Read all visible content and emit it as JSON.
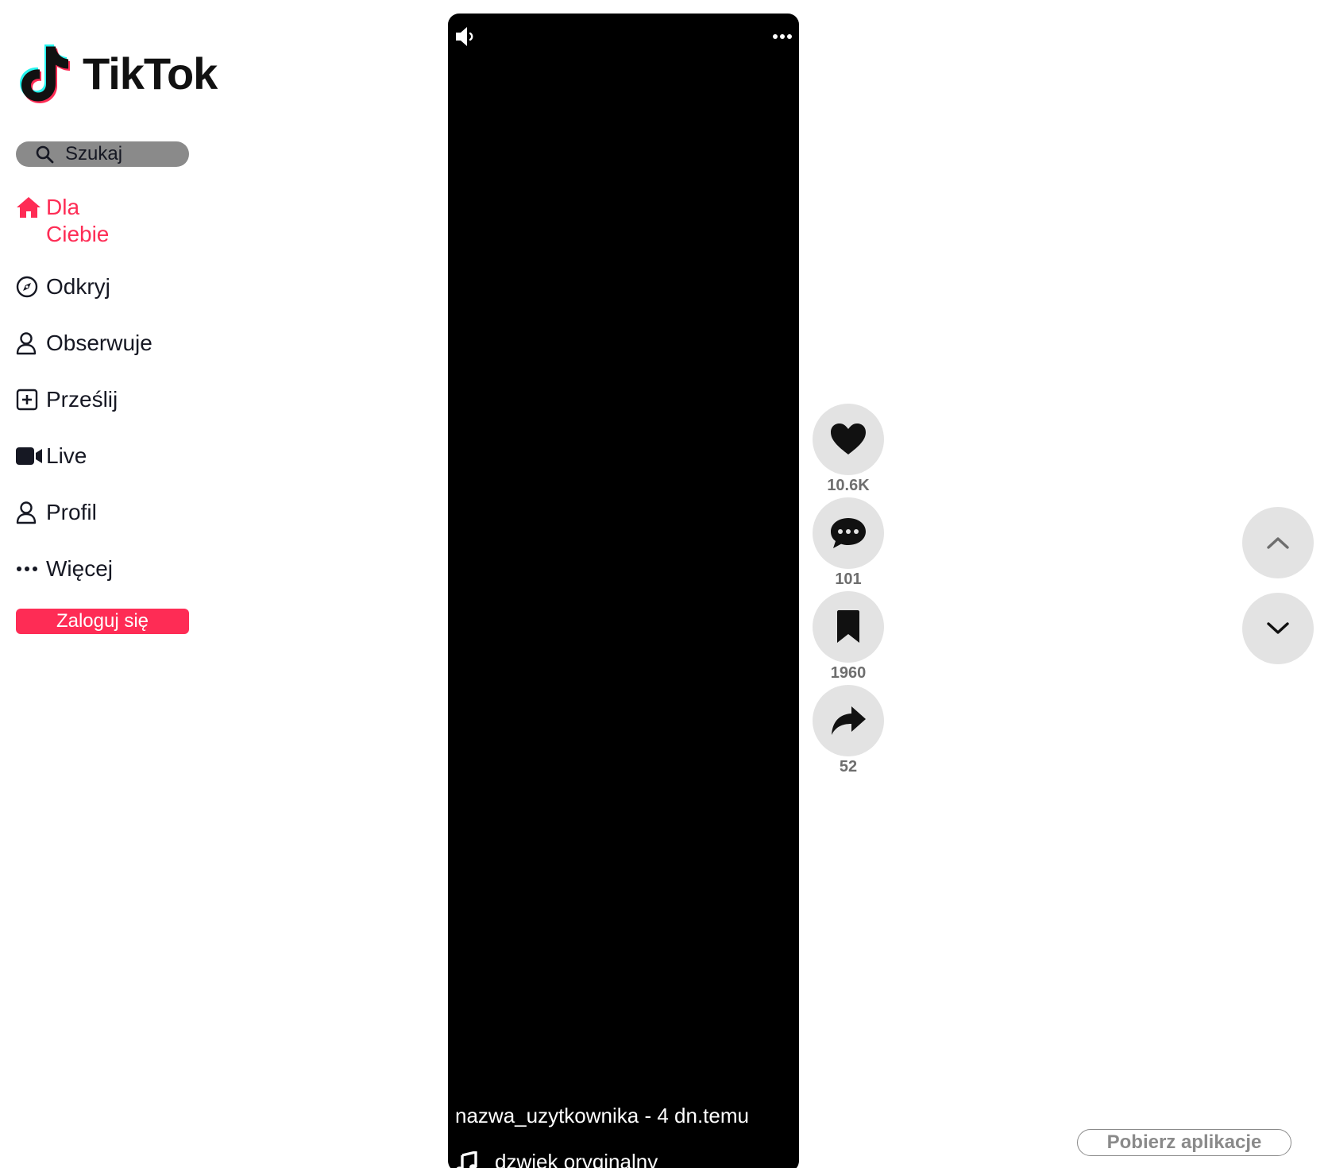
{
  "brand": {
    "name": "TikTok",
    "colors": {
      "accent": "#fe2c55",
      "cyan": "#25f4ee",
      "dark": "#111111"
    }
  },
  "search": {
    "label": "Szukaj",
    "icon": "search-icon"
  },
  "sidebar": {
    "items": [
      {
        "label": "Dla Ciebie",
        "icon": "home-icon",
        "active": true
      },
      {
        "label": "Odkryj",
        "icon": "compass-icon"
      },
      {
        "label": "Obserwuje",
        "icon": "user-icon"
      },
      {
        "label": "Prześlij",
        "icon": "plus-square-icon"
      },
      {
        "label": "Live",
        "icon": "video-camera-icon"
      },
      {
        "label": "Profil",
        "icon": "user-icon"
      },
      {
        "label": "Więcej",
        "icon": "more-dots-icon"
      }
    ],
    "login_label": "Zaloguj się"
  },
  "video": {
    "caption": "nazwa_uzytkownika - 4 dn.temu",
    "sound": "dzwiek oryginalny"
  },
  "actions": {
    "likes": "10.6K",
    "comments": "101",
    "saves": "1960",
    "shares": "52"
  },
  "get_app_label": "Pobierz aplikacje"
}
